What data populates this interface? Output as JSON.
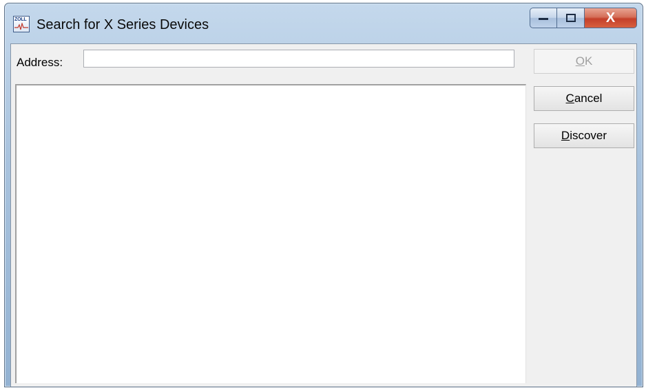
{
  "window": {
    "title": "Search for X Series Devices",
    "app_icon_text": "ZOLL",
    "caption": {
      "minimize": "minimize",
      "maximize": "maximize",
      "close": "X"
    }
  },
  "address": {
    "label": "Address:",
    "value": "",
    "placeholder": ""
  },
  "device_list": {
    "items": []
  },
  "buttons": {
    "ok": {
      "mnemonic": "O",
      "rest": "K",
      "enabled": false
    },
    "cancel": {
      "mnemonic": "C",
      "rest": "ancel",
      "enabled": true
    },
    "discover": {
      "mnemonic": "D",
      "rest": "iscover",
      "enabled": true
    }
  },
  "colors": {
    "close_button": "#c4402a",
    "client_bg": "#f0f0f0",
    "titlebar": "#a9c3de"
  }
}
